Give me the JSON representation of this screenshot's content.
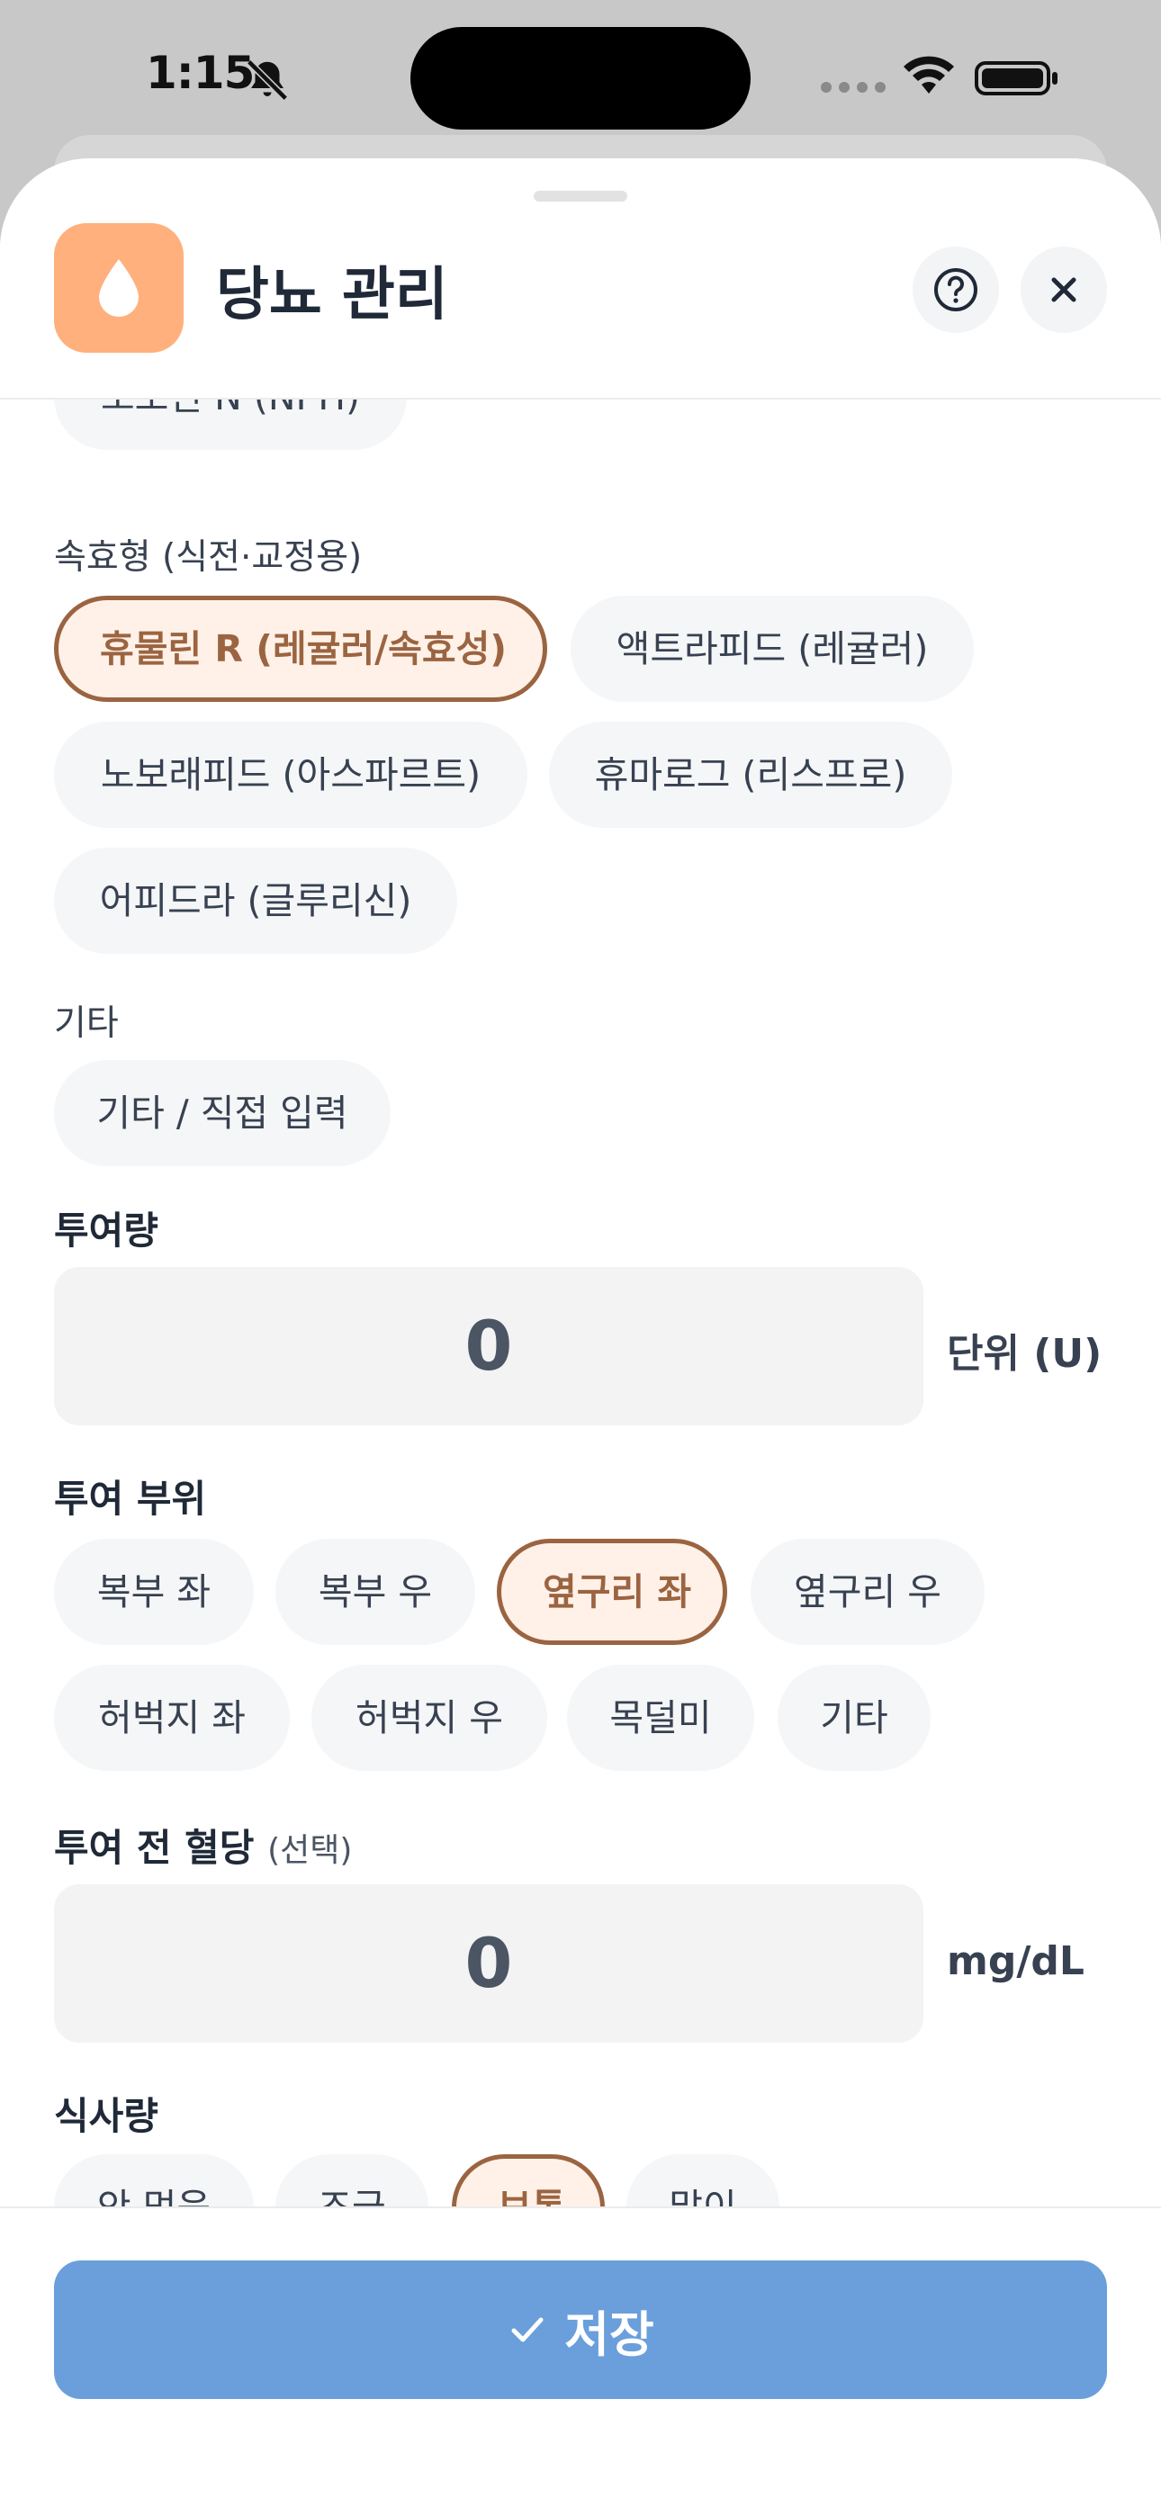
{
  "status": {
    "time": "1:15"
  },
  "header": {
    "title": "당뇨 관리"
  },
  "insulin": {
    "top_partial": "노보린 N (NPH)",
    "section_rapid": "속효형 (식전·교정용)",
    "rapid": [
      "휴물린 R (레귤러/속효성)",
      "액트라피드 (레귤러)",
      "노보래피드 (아스파르트)",
      "휴마로그 (리스프로)",
      "어피드라 (글루리신)"
    ],
    "section_other": "기타",
    "other": [
      "기타 / 직접 입력"
    ],
    "selected": "휴물린 R (레귤러/속효성)"
  },
  "dose": {
    "label": "투여량",
    "value": "0",
    "unit": "단위 (U)"
  },
  "site": {
    "label": "투여 부위",
    "options": [
      "복부 좌",
      "복부 우",
      "옆구리 좌",
      "옆구리 우",
      "허벅지 좌",
      "허벅지 우",
      "목덜미",
      "기타"
    ],
    "selected": "옆구리 좌"
  },
  "glucose": {
    "label": "투여 전 혈당",
    "optional": "(선택)",
    "value": "0",
    "unit": "mg/dL"
  },
  "meal": {
    "label": "식사량",
    "options": [
      "안 먹음",
      "조금",
      "보통",
      "많이"
    ],
    "selected": "보통"
  },
  "footer": {
    "save_label": "저장"
  },
  "colors": {
    "accent": "#ffb07c",
    "selected_border": "#9b6441",
    "selected_bg": "#fff1e8",
    "save_button": "#6a9fdb"
  }
}
